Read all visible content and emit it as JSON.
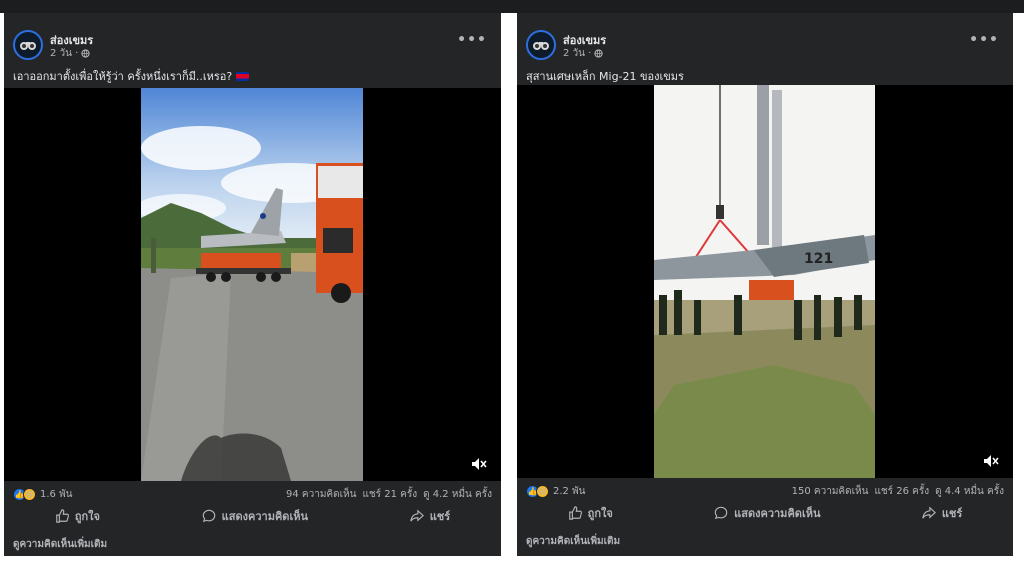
{
  "posts": [
    {
      "author": "ส่องเขมร",
      "time": "2 วัน ·",
      "caption": "เอาออกมาตั้งเพื่อให้รู้ว่า ครั้งหนึ่งเราก็มี..เหรอ?",
      "reactions_count": "1.6 พัน",
      "comments": "94 ความคิดเห็น",
      "shares": "แชร์ 21 ครั้ง",
      "views": "ดู 4.2 หมื่น ครั้ง",
      "like_label": "ถูกใจ",
      "comment_label": "แสดงความคิดเห็น",
      "share_label": "แชร์",
      "more_comments": "ดูความคิดเห็นเพิ่มเติม"
    },
    {
      "author": "ส่องเขมร",
      "time": "2 วัน ·",
      "caption": "สุสานเศษเหล็ก Mig-21 ของเขมร",
      "reactions_count": "2.2 พัน",
      "comments": "150 ความคิดเห็น",
      "shares": "แชร์ 26 ครั้ง",
      "views": "ดู 4.4 หมื่น ครั้ง",
      "like_label": "ถูกใจ",
      "comment_label": "แสดงความคิดเห็น",
      "share_label": "แชร์",
      "more_comments": "ดูความคิดเห็นเพิ่มเติม"
    }
  ],
  "aircraft_marking": "121",
  "icons": {
    "globe": "globe-icon",
    "more": "more-options-icon",
    "mute": "muted-speaker-icon",
    "like": "like-icon",
    "comment": "comment-icon",
    "share": "share-icon"
  },
  "colors": {
    "card_bg": "#242526",
    "text_primary": "#e4e6eb",
    "text_secondary": "#b0b3b8",
    "like_blue": "#1877f2",
    "haha_yellow": "#f7b928"
  }
}
